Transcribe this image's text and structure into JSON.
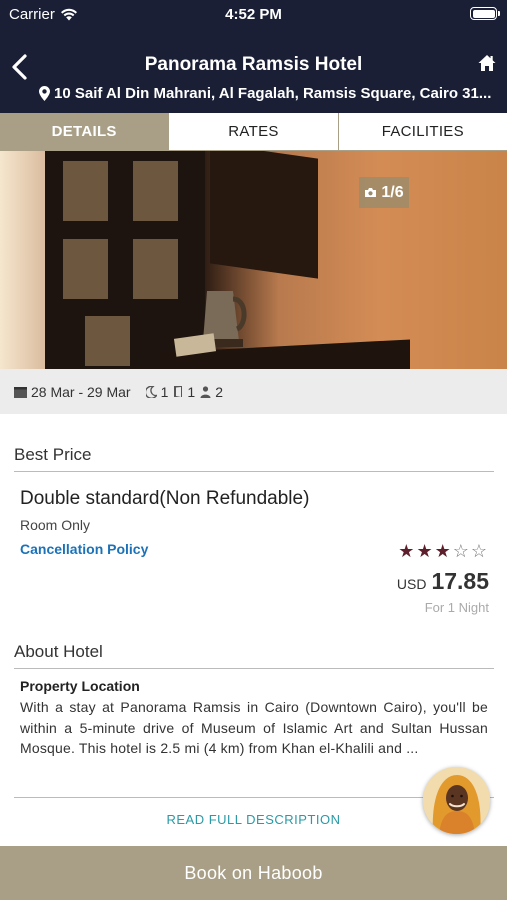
{
  "status_bar": {
    "carrier": "Carrier",
    "time": "4:52 PM"
  },
  "header": {
    "title": "Panorama Ramsis Hotel",
    "address": "10 Saif Al Din Mahrani, Al Fagalah, Ramsis Square, Cairo 31..."
  },
  "tabs": [
    {
      "label": "DETAILS",
      "active": true
    },
    {
      "label": "RATES",
      "active": false
    },
    {
      "label": "FACILITIES",
      "active": false
    }
  ],
  "photo": {
    "counter": "1/6"
  },
  "booking": {
    "dates": "28 Mar - 29 Mar",
    "nights": "1",
    "rooms": "1",
    "guests": "2"
  },
  "best_price": {
    "section_title": "Best Price",
    "room_name": "Double standard(Non Refundable)",
    "board": "Room Only",
    "cancellation_label": "Cancellation Policy",
    "stars": 3,
    "max_stars": 5,
    "currency": "USD",
    "amount": "17.85",
    "per_night": "For 1 Night"
  },
  "about": {
    "section_title": "About Hotel",
    "property_heading": "Property Location",
    "description": "With a stay at Panorama Ramsis in Cairo (Downtown Cairo), you'll be within a 5-minute drive of Museum of Islamic Art and Sultan Hussan Mosque. This hotel is 2.5 mi (4 km) from Khan el-Khalili and ...",
    "read_more_label": "READ FULL DESCRIPTION"
  },
  "book_button_label": "Book on Haboob",
  "colors": {
    "header_bg": "#1a1f36",
    "accent": "#a89f86",
    "link": "#1b72b8",
    "star": "#5c1f2b",
    "read_more": "#2a9aa6"
  }
}
